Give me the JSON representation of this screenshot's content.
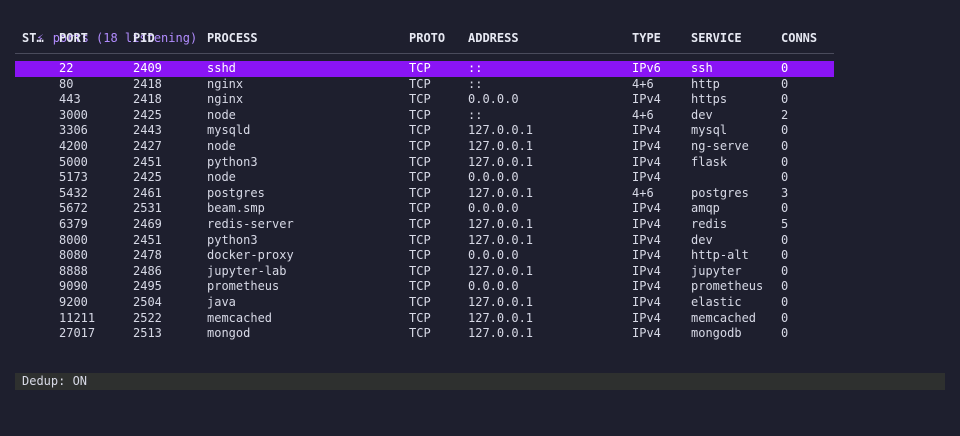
{
  "title": {
    "icon": "lightning-bolt-icon",
    "glyph": "⚡",
    "text": "ports (18 listening)"
  },
  "columns": {
    "state": "ST…",
    "port": "PORT",
    "pid": "PID",
    "process": "PROCESS",
    "proto": "PROTO",
    "address": "ADDRESS",
    "type": "TYPE",
    "service": "SERVICE",
    "conns": "CONNS"
  },
  "rows": [
    {
      "state": "",
      "port": "22",
      "pid": "2409",
      "process": "sshd",
      "proto": "TCP",
      "address": "::",
      "type": "IPv6",
      "service": "ssh",
      "conns": "0"
    },
    {
      "state": "",
      "port": "80",
      "pid": "2418",
      "process": "nginx",
      "proto": "TCP",
      "address": "::",
      "type": "4+6",
      "service": "http",
      "conns": "0"
    },
    {
      "state": "",
      "port": "443",
      "pid": "2418",
      "process": "nginx",
      "proto": "TCP",
      "address": "0.0.0.0",
      "type": "IPv4",
      "service": "https",
      "conns": "0"
    },
    {
      "state": "",
      "port": "3000",
      "pid": "2425",
      "process": "node",
      "proto": "TCP",
      "address": "::",
      "type": "4+6",
      "service": "dev",
      "conns": "2"
    },
    {
      "state": "",
      "port": "3306",
      "pid": "2443",
      "process": "mysqld",
      "proto": "TCP",
      "address": "127.0.0.1",
      "type": "IPv4",
      "service": "mysql",
      "conns": "0"
    },
    {
      "state": "",
      "port": "4200",
      "pid": "2427",
      "process": "node",
      "proto": "TCP",
      "address": "127.0.0.1",
      "type": "IPv4",
      "service": "ng-serve",
      "conns": "0"
    },
    {
      "state": "",
      "port": "5000",
      "pid": "2451",
      "process": "python3",
      "proto": "TCP",
      "address": "127.0.0.1",
      "type": "IPv4",
      "service": "flask",
      "conns": "0"
    },
    {
      "state": "",
      "port": "5173",
      "pid": "2425",
      "process": "node",
      "proto": "TCP",
      "address": "0.0.0.0",
      "type": "IPv4",
      "service": "",
      "conns": "0"
    },
    {
      "state": "",
      "port": "5432",
      "pid": "2461",
      "process": "postgres",
      "proto": "TCP",
      "address": "127.0.0.1",
      "type": "4+6",
      "service": "postgres",
      "conns": "3"
    },
    {
      "state": "",
      "port": "5672",
      "pid": "2531",
      "process": "beam.smp",
      "proto": "TCP",
      "address": "0.0.0.0",
      "type": "IPv4",
      "service": "amqp",
      "conns": "0"
    },
    {
      "state": "",
      "port": "6379",
      "pid": "2469",
      "process": "redis-server",
      "proto": "TCP",
      "address": "127.0.0.1",
      "type": "IPv4",
      "service": "redis",
      "conns": "5"
    },
    {
      "state": "",
      "port": "8000",
      "pid": "2451",
      "process": "python3",
      "proto": "TCP",
      "address": "127.0.0.1",
      "type": "IPv4",
      "service": "dev",
      "conns": "0"
    },
    {
      "state": "",
      "port": "8080",
      "pid": "2478",
      "process": "docker-proxy",
      "proto": "TCP",
      "address": "0.0.0.0",
      "type": "IPv4",
      "service": "http-alt",
      "conns": "0"
    },
    {
      "state": "",
      "port": "8888",
      "pid": "2486",
      "process": "jupyter-lab",
      "proto": "TCP",
      "address": "127.0.0.1",
      "type": "IPv4",
      "service": "jupyter",
      "conns": "0"
    },
    {
      "state": "",
      "port": "9090",
      "pid": "2495",
      "process": "prometheus",
      "proto": "TCP",
      "address": "0.0.0.0",
      "type": "IPv4",
      "service": "prometheus",
      "conns": "0"
    },
    {
      "state": "",
      "port": "9200",
      "pid": "2504",
      "process": "java",
      "proto": "TCP",
      "address": "127.0.0.1",
      "type": "IPv4",
      "service": "elastic",
      "conns": "0"
    },
    {
      "state": "",
      "port": "11211",
      "pid": "2522",
      "process": "memcached",
      "proto": "TCP",
      "address": "127.0.0.1",
      "type": "IPv4",
      "service": "memcached",
      "conns": "0"
    },
    {
      "state": "",
      "port": "27017",
      "pid": "2513",
      "process": "mongod",
      "proto": "TCP",
      "address": "127.0.0.1",
      "type": "IPv4",
      "service": "mongodb",
      "conns": "0"
    }
  ],
  "selected_index": 0,
  "status": {
    "text": "Dedup: ON"
  },
  "colors": {
    "background": "#1e1f2e",
    "accent": "#b28cff",
    "selection": "#8a14f5",
    "statusbar": "#2e302f"
  }
}
